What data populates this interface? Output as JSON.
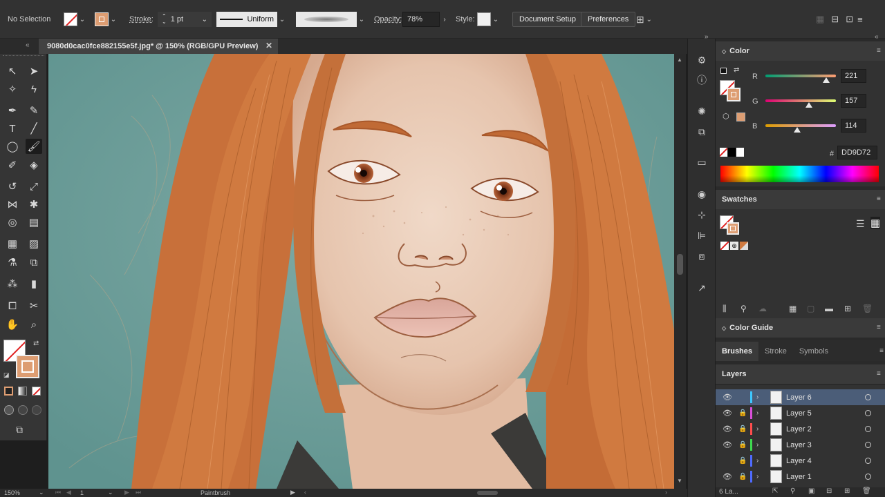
{
  "control_bar": {
    "selection_label": "No Selection",
    "stroke_label": "Stroke:",
    "stroke_weight": "1 pt",
    "profile_label": "Uniform",
    "opacity_label": "Opacity:",
    "opacity_value": "78%",
    "style_label": "Style:",
    "document_setup": "Document Setup",
    "preferences": "Preferences"
  },
  "document_tab": {
    "title": "9080d0cac0fce882155e5f.jpg* @ 150% (RGB/GPU Preview)",
    "close_icon": "close-icon"
  },
  "status_bar": {
    "zoom": "150%",
    "artboard": "1",
    "tool": "Paintbrush"
  },
  "color_panel": {
    "title": "Color",
    "r_label": "R",
    "r_value": "221",
    "g_label": "G",
    "g_value": "157",
    "b_label": "B",
    "b_value": "114",
    "hex_label": "#",
    "hex_value": "DD9D72",
    "fill_color": "#dd9d72"
  },
  "swatches_panel": {
    "title": "Swatches"
  },
  "color_guide_panel": {
    "title": "Color Guide"
  },
  "brush_tabs": [
    "Brushes",
    "Stroke",
    "Symbols"
  ],
  "layers_panel": {
    "title": "Layers",
    "footer": "6 La...",
    "layers": [
      {
        "name": "Layer 6",
        "color": "#3ec8ff",
        "visible": true,
        "locked": false,
        "selected": true
      },
      {
        "name": "Layer 5",
        "color": "#d94fd9",
        "visible": true,
        "locked": true,
        "selected": false
      },
      {
        "name": "Layer 2",
        "color": "#ff4d4d",
        "visible": true,
        "locked": true,
        "selected": false
      },
      {
        "name": "Layer 3",
        "color": "#3ed94f",
        "visible": true,
        "locked": true,
        "selected": false
      },
      {
        "name": "Layer 4",
        "color": "#4f6bff",
        "visible": false,
        "locked": true,
        "selected": false
      },
      {
        "name": "Layer 1",
        "color": "#4f6bff",
        "visible": true,
        "locked": true,
        "selected": false
      }
    ]
  }
}
